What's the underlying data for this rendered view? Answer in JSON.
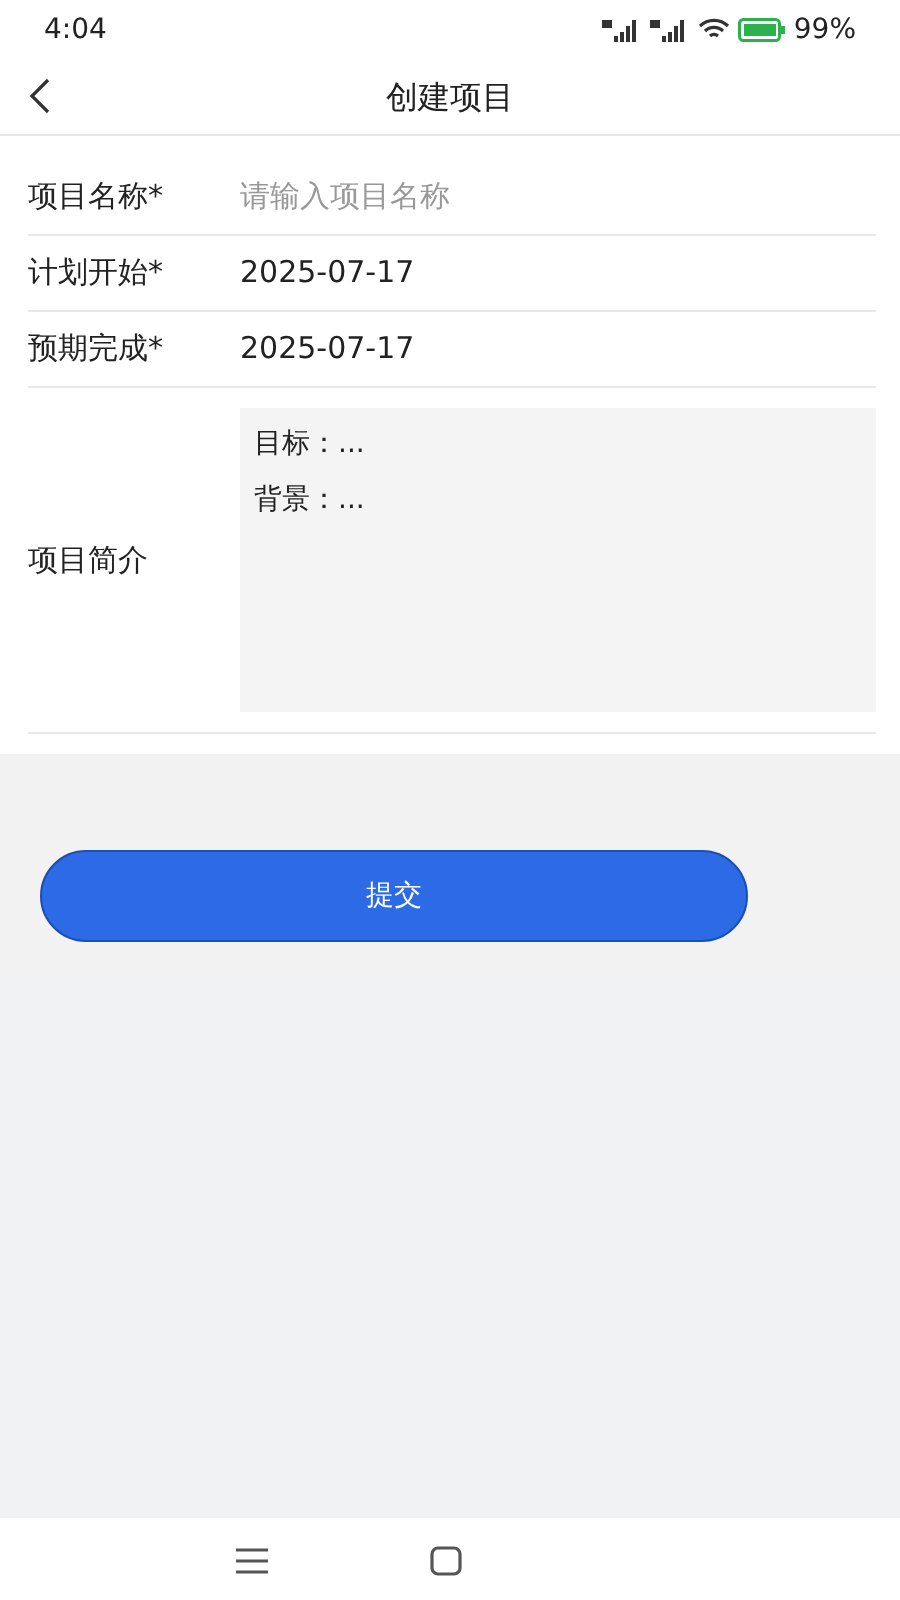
{
  "status_bar": {
    "time": "4:04",
    "battery": "99%"
  },
  "header": {
    "title": "创建项目"
  },
  "fields": [
    {
      "label": "项目名称*",
      "kind": "text",
      "placeholder": "请输入项目名称"
    },
    {
      "label": "计划开始*",
      "kind": "text",
      "value": "2025-07-17"
    },
    {
      "label": "预期完成*",
      "kind": "text",
      "value": "2025-07-17"
    },
    {
      "label": "项目简介",
      "kind": "textarea",
      "value": "目标：...\n背景：..."
    }
  ],
  "submit_button": "提交"
}
